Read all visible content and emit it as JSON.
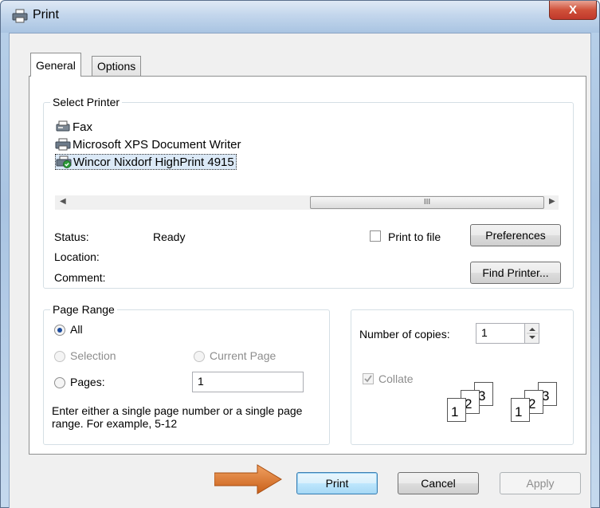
{
  "window": {
    "title": "Print",
    "close_label": "X"
  },
  "tabs": [
    {
      "label": "General",
      "selected": true
    },
    {
      "label": "Options",
      "selected": false
    }
  ],
  "select_printer": {
    "group_label": "Select Printer",
    "printers": [
      {
        "name": "Fax",
        "icon": "fax-printer-icon",
        "selected": false
      },
      {
        "name": "Microsoft XPS Document Writer",
        "icon": "printer-icon",
        "selected": false
      },
      {
        "name": "Wincor Nixdorf HighPrint 4915",
        "icon": "default-printer-icon",
        "selected": true
      }
    ],
    "scroll_thumb_label": "III",
    "status_label": "Status:",
    "status_value": "Ready",
    "location_label": "Location:",
    "comment_label": "Comment:",
    "print_to_file_label": "Print to file",
    "preferences_label": "Preferences",
    "find_printer_label": "Find Printer..."
  },
  "page_range": {
    "group_label": "Page Range",
    "all_label": "All",
    "selection_label": "Selection",
    "current_page_label": "Current Page",
    "pages_label": "Pages:",
    "pages_value": "1",
    "hint": "Enter either a single page number or a single page range.  For example, 5-12"
  },
  "copies": {
    "number_label": "Number of copies:",
    "number_value": "1",
    "collate_label": "Collate",
    "collate_pages": [
      "1",
      "2",
      "3"
    ]
  },
  "buttons": {
    "print": "Print",
    "cancel": "Cancel",
    "apply": "Apply"
  },
  "colors": {
    "pointer_arrow": "#e07a2a",
    "close_button": "#c0392b"
  }
}
